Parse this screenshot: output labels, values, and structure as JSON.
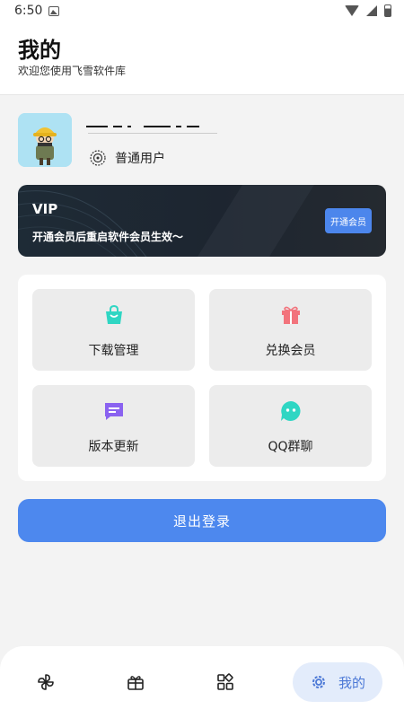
{
  "status_bar": {
    "time": "6:50"
  },
  "header": {
    "title": "我的",
    "subtitle": "欢迎您使用飞雪软件库"
  },
  "profile": {
    "level_label": "普通用户"
  },
  "vip": {
    "title": "VIP",
    "description": "开通会员后重启软件会员生效〜",
    "button_label": "开通会员"
  },
  "features": [
    {
      "label": "下载管理",
      "icon": "shopping-bag-icon",
      "color": "#2fd6c3"
    },
    {
      "label": "兑换会员",
      "icon": "gift-icon",
      "color": "#f2737c"
    },
    {
      "label": "版本更新",
      "icon": "message-icon",
      "color": "#8a62f0"
    },
    {
      "label": "QQ群聊",
      "icon": "chat-face-icon",
      "color": "#2fd6c3"
    }
  ],
  "logout_label": "退出登录",
  "bottom_nav": [
    {
      "icon": "pinwheel-icon"
    },
    {
      "icon": "gift-box-icon"
    },
    {
      "icon": "apps-icon"
    },
    {
      "icon": "gear-icon",
      "label": "我的",
      "active": true
    }
  ],
  "colors": {
    "primary": "#4d88ee",
    "vip_bg": "#1e2b36",
    "nav_active_bg": "#e3ecfb"
  }
}
